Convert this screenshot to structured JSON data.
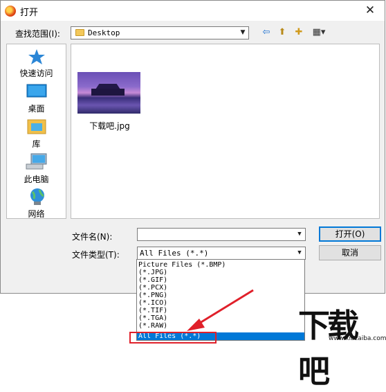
{
  "window": {
    "title": "打开",
    "close_glyph": "✕"
  },
  "lookin": {
    "label": "查找范围(I):",
    "value": "Desktop"
  },
  "toolbar": {
    "back_glyph": "⇦",
    "up_glyph": "⬆",
    "newfolder_glyph": "✚",
    "view_glyph": "▦▾"
  },
  "places": [
    {
      "label": "快速访问",
      "icon": "star-icon"
    },
    {
      "label": "桌面",
      "icon": "desktop-icon"
    },
    {
      "label": "库",
      "icon": "library-icon"
    },
    {
      "label": "此电脑",
      "icon": "computer-icon"
    },
    {
      "label": "网络",
      "icon": "network-icon"
    }
  ],
  "files": [
    {
      "name": "下载吧.jpg"
    }
  ],
  "filename": {
    "label": "文件名(N):",
    "value": ""
  },
  "filetype": {
    "label": "文件类型(T):",
    "value": "All Files (*.*)",
    "options": [
      "Picture Files (*.BMP)",
      "(*.JPG)",
      "(*.GIF)",
      "(*.PCX)",
      "(*.PNG)",
      "(*.ICO)",
      "(*.TIF)",
      "(*.TGA)",
      "(*.RAW)",
      "All Files (*.*)"
    ]
  },
  "buttons": {
    "open": "打开(O)",
    "cancel": "取消"
  },
  "watermark": {
    "big": "下载吧",
    "small": "www.xiazaiba.com"
  },
  "colors": {
    "selection": "#0078d7",
    "annotation": "#e0202a"
  }
}
